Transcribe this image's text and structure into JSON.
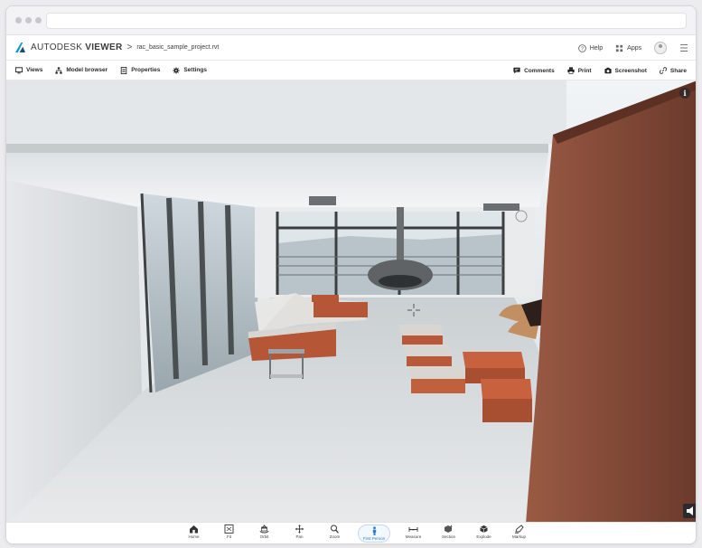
{
  "app": {
    "brand": "AUTODESK",
    "product": "VIEWER",
    "breadcrumb_sep": ">",
    "filename": "rac_basic_sample_project.rvt",
    "accent": "#0696d7"
  },
  "header": {
    "help_label": "Help",
    "apps_label": "Apps"
  },
  "toolbar": {
    "left": [
      {
        "label": "Views",
        "icon": "monitor-icon"
      },
      {
        "label": "Model browser",
        "icon": "hierarchy-icon"
      },
      {
        "label": "Properties",
        "icon": "document-icon"
      },
      {
        "label": "Settings",
        "icon": "gear-icon"
      }
    ],
    "right": [
      {
        "label": "Comments",
        "icon": "comment-icon"
      },
      {
        "label": "Print",
        "icon": "printer-icon"
      },
      {
        "label": "Screenshot",
        "icon": "camera-icon"
      },
      {
        "label": "Share",
        "icon": "link-icon"
      }
    ]
  },
  "viewport": {
    "info_label": "i"
  },
  "bottom_tools": [
    {
      "label": "Home",
      "icon": "home-icon",
      "active": false
    },
    {
      "label": "Fit",
      "icon": "fit-icon",
      "active": false
    },
    {
      "label": "Orbit",
      "icon": "orbit-icon",
      "active": false
    },
    {
      "label": "Pan",
      "icon": "pan-icon",
      "active": false
    },
    {
      "label": "Zoom",
      "icon": "zoom-icon",
      "active": false
    },
    {
      "label": "First Person",
      "icon": "person-icon",
      "active": true
    },
    {
      "label": "Measure",
      "icon": "measure-icon",
      "active": false
    },
    {
      "label": "Section",
      "icon": "section-icon",
      "active": false
    },
    {
      "label": "Explode",
      "icon": "explode-icon",
      "active": false
    },
    {
      "label": "Markup",
      "icon": "pencil-icon",
      "active": false
    }
  ]
}
